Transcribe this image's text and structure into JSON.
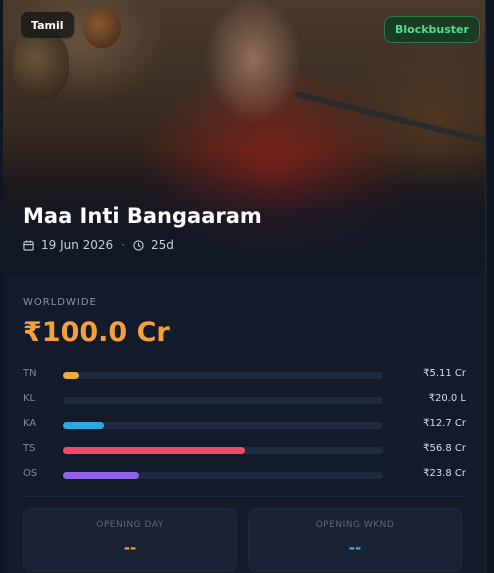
{
  "movie": {
    "language": "Tamil",
    "verdict": "Blockbuster",
    "title": "Maa Inti Bangaaram",
    "release_date": "19 Jun 2026",
    "days": "25d"
  },
  "worldwide": {
    "label": "WORLDWIDE",
    "value": "₹100.0 Cr"
  },
  "regions": [
    {
      "code": "TN",
      "value": "₹5.11 Cr",
      "share": 5.1,
      "color": "#f0a93b"
    },
    {
      "code": "KL",
      "value": "₹20.0 L",
      "share": 0.2,
      "color": "#8a93a5"
    },
    {
      "code": "KA",
      "value": "₹12.7 Cr",
      "share": 12.7,
      "color": "#2ea8e0"
    },
    {
      "code": "TS",
      "value": "₹56.8 Cr",
      "share": 56.8,
      "color": "#ee4d63"
    },
    {
      "code": "OS",
      "value": "₹23.8 Cr",
      "share": 23.8,
      "color": "#8e63e6"
    }
  ],
  "stats": {
    "opening_day": {
      "label": "OPENING DAY",
      "value": "--",
      "color": "#f0a93b"
    },
    "opening_weekend": {
      "label": "OPENING WKND",
      "value": "--",
      "color": "#4aa8e8"
    }
  }
}
